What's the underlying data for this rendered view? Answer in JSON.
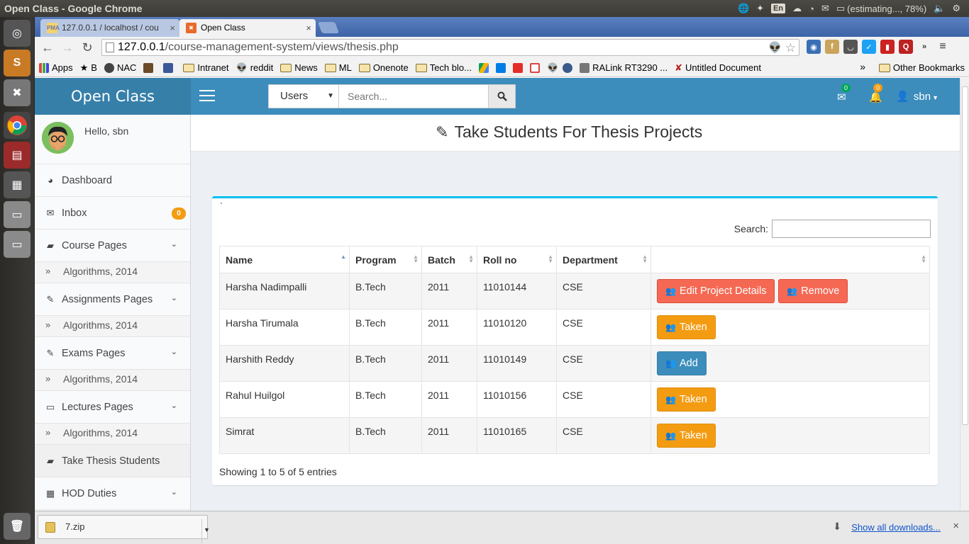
{
  "window": {
    "title": "Open Class - Google Chrome"
  },
  "indicators": {
    "keyboard": "En",
    "battery": "(estimating..., 78%)"
  },
  "tabs": [
    {
      "label": "127.0.0.1 / localhost / cou",
      "favicon": "PMA"
    },
    {
      "label": "Open Class"
    }
  ],
  "address": {
    "host": "127.0.0.1",
    "path": "/course-management-system/views/thesis.php"
  },
  "bookmarks": {
    "items": [
      "Apps",
      "B",
      "NAC",
      "Intranet",
      "reddit",
      "News",
      "ML",
      "Onenote",
      "Tech blo...",
      "RALink RT3290 ...",
      "Untitled Document"
    ],
    "more": "»",
    "other": "Other Bookmarks"
  },
  "app": {
    "logo": "Open Class",
    "search": {
      "scope": "Users",
      "placeholder": "Search..."
    },
    "mail_count": "0",
    "notif_count": "0",
    "user": "sbn"
  },
  "sidebar": {
    "hello": "Hello, sbn",
    "dashboard": "Dashboard",
    "inbox": "Inbox",
    "inbox_count": "0",
    "course_pages": "Course Pages",
    "course_sub": "Algorithms, 2014",
    "assignments_pages": "Assignments Pages",
    "assignments_sub": "Algorithms, 2014",
    "exams_pages": "Exams Pages",
    "exams_sub": "Algorithms, 2014",
    "lectures_pages": "Lectures Pages",
    "lectures_sub": "Algorithms, 2014",
    "take_thesis": "Take Thesis Students",
    "hod_duties": "HOD Duties"
  },
  "main": {
    "title": "Take Students For Thesis Projects",
    "tick": "`",
    "search_label": "Search:",
    "columns": [
      "Name",
      "Program",
      "Batch",
      "Roll no",
      "Department",
      ""
    ],
    "rows": [
      {
        "name": "Harsha Nadimpalli",
        "program": "B.Tech",
        "batch": "2011",
        "roll": "11010144",
        "dept": "CSE"
      },
      {
        "name": "Harsha Tirumala",
        "program": "B.Tech",
        "batch": "2011",
        "roll": "11010120",
        "dept": "CSE"
      },
      {
        "name": "Harshith Reddy",
        "program": "B.Tech",
        "batch": "2011",
        "roll": "11010149",
        "dept": "CSE"
      },
      {
        "name": "Rahul Huilgol",
        "program": "B.Tech",
        "batch": "2011",
        "roll": "11010156",
        "dept": "CSE"
      },
      {
        "name": "Simrat",
        "program": "B.Tech",
        "batch": "2011",
        "roll": "11010165",
        "dept": "CSE"
      }
    ],
    "btn_edit": "Edit Project Details",
    "btn_remove": "Remove",
    "btn_taken": "Taken",
    "btn_add": "Add",
    "info": "Showing 1 to 5 of 5 entries"
  },
  "downloads": {
    "file": "7.zip",
    "show_all": "Show all downloads..."
  },
  "colors": {
    "navbar": "#3c8dbc",
    "logo": "#367fa9",
    "danger": "#f56954",
    "warning": "#f39c12",
    "primary": "#3c8dbc",
    "box_top": "#00c0ef"
  }
}
